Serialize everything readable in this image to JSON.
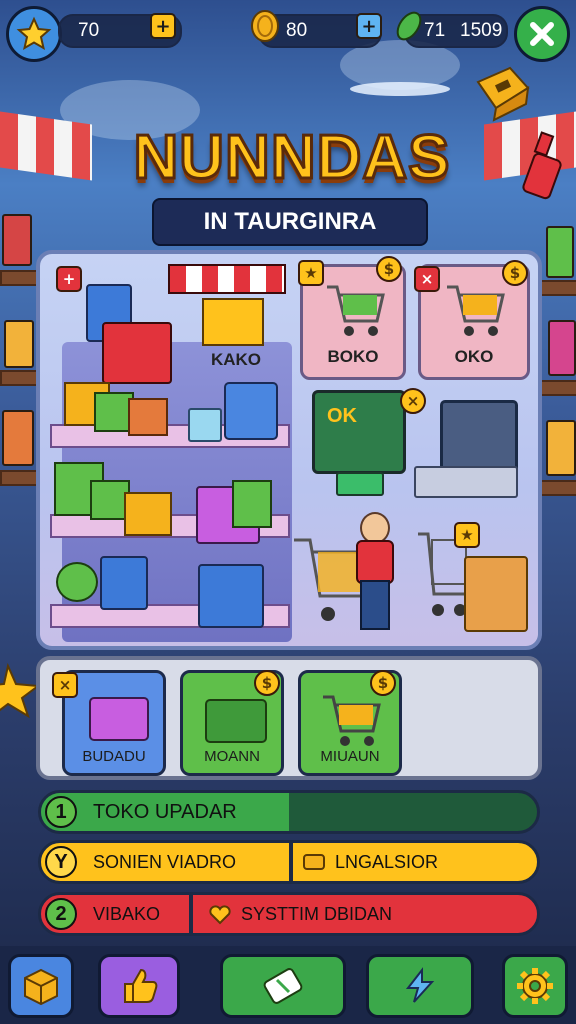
{
  "topbar": {
    "stars_value": "70",
    "coins_value": "80",
    "gems_value": "71",
    "gems_extra": "1509",
    "plus_symbol": "+",
    "plus_blue_symbol": "+"
  },
  "title": {
    "main": "NUNNDAS",
    "sub": "IN TAURGINRA"
  },
  "main_panel": {
    "shop_label": "KAKO",
    "cart_card_1_label": "BOKO",
    "cart_card_2_label": "OKO",
    "screen_text": "OK"
  },
  "upgrades": [
    {
      "label": "BUDADU",
      "color": "#5b8fe6"
    },
    {
      "label": "MOANN",
      "color": "#5fbf4a"
    },
    {
      "label": "MIUAUN",
      "color": "#5fbf4a"
    }
  ],
  "bars": {
    "row1": {
      "num": "1",
      "text": "TOKO UPADAR",
      "fill": 0.5
    },
    "row2": {
      "num": "Y",
      "text_left": "SONIEN VIADRO",
      "text_right": "LNGALSIOR"
    },
    "row3": {
      "num": "2",
      "text_left": "VIBAKO",
      "text_right": "SYSTTIM DBIDAN"
    }
  },
  "colors": {
    "gold": "#ffc21c",
    "green": "#4cb748",
    "red": "#e2333c",
    "blue": "#4a86e0",
    "purple": "#9a5ee0"
  },
  "icons": [
    "star-icon",
    "coin-icon",
    "gem-icon",
    "close-icon",
    "box-icon",
    "thumbs-up-icon",
    "ticket-icon",
    "lightning-icon",
    "gear-icon",
    "cart-icon"
  ]
}
